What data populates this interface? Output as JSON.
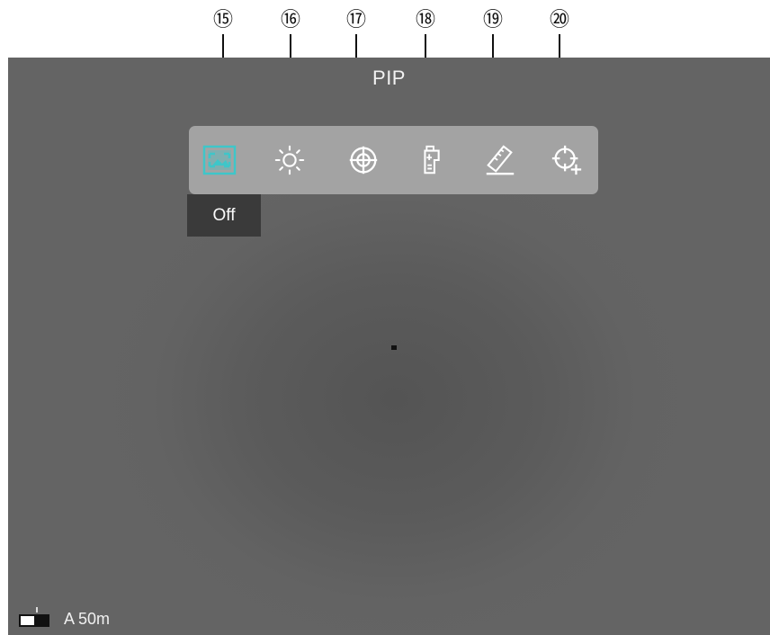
{
  "callouts": [
    "⑮",
    "⑯",
    "⑰",
    "⑱",
    "⑲",
    "⑳"
  ],
  "menu": {
    "title": "PIP",
    "items": [
      {
        "icon": "pip-icon",
        "active": true
      },
      {
        "icon": "brightness-icon",
        "active": false
      },
      {
        "icon": "reticle-icon",
        "active": false
      },
      {
        "icon": "zeroing-icon",
        "active": false
      },
      {
        "icon": "rangefinder-ruler-icon",
        "active": false
      },
      {
        "icon": "crosshair-add-icon",
        "active": false
      }
    ],
    "tooltip": "Off"
  },
  "status": {
    "battery_level": 0.5,
    "range_text": "A 50m"
  },
  "colors": {
    "accent": "#3ec6c9",
    "icon": "#ffffff",
    "toolbar_bg": "#a3a3a3",
    "tooltip_bg": "#3a3a3a"
  }
}
